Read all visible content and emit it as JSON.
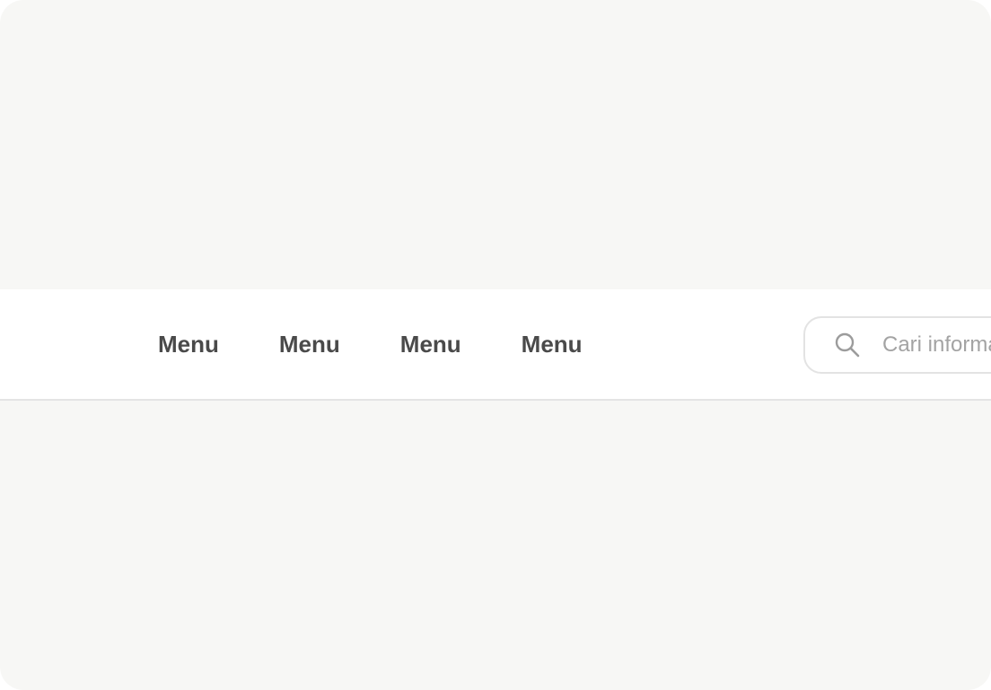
{
  "navbar": {
    "menu_items": [
      {
        "label": "Menu"
      },
      {
        "label": "Menu"
      },
      {
        "label": "Menu"
      },
      {
        "label": "Menu"
      }
    ]
  },
  "search": {
    "placeholder": "Cari informasi",
    "value": "",
    "icon": "search-icon"
  },
  "colors": {
    "page_background": "#f7f7f5",
    "navbar_background": "#ffffff",
    "menu_text": "#4a4a4a",
    "placeholder_text": "#a3a3a3",
    "border": "#e3e3e3"
  }
}
